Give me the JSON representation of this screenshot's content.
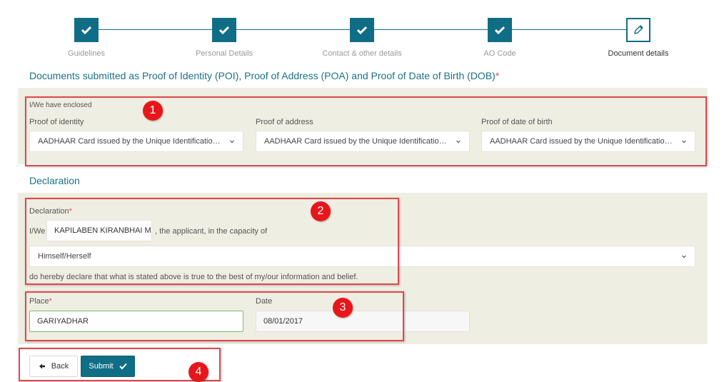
{
  "stepper": {
    "steps": [
      {
        "label": "Guidelines",
        "status": "complete",
        "icon": "check-icon"
      },
      {
        "label": "Personal Details",
        "status": "complete",
        "icon": "check-icon"
      },
      {
        "label": "Contact & other details",
        "status": "complete",
        "icon": "check-icon"
      },
      {
        "label": "AO Code",
        "status": "complete",
        "icon": "check-icon"
      },
      {
        "label": "Document details",
        "status": "current",
        "icon": "pencil-icon"
      }
    ]
  },
  "documents": {
    "title": "Documents submitted as Proof of Identity (POI), Proof of Address (POA) and Proof of Date of Birth (DOB)",
    "required_mark": "*",
    "enclosed_label": "I/We have enclosed",
    "poi": {
      "label": "Proof of identity",
      "value": "AADHAAR Card issued by the Unique Identification ..."
    },
    "poa": {
      "label": "Proof of address",
      "value": "AADHAAR Card issued by the Unique Identification ..."
    },
    "dob": {
      "label": "Proof of date of birth",
      "value": "AADHAAR Card issued by the Unique Identification ..."
    }
  },
  "declaration": {
    "title": "Declaration",
    "label": "Declaration",
    "required_mark": "*",
    "prefix": "I/We",
    "name_value": "KAPILABEN KIRANBHAI M",
    "middle_text": ", the applicant, in the capacity of",
    "capacity_value": "Himself/Herself",
    "statement": "do hereby declare that what is stated above is true to the best of my/our information and belief."
  },
  "place": {
    "label": "Place",
    "required_mark": "*",
    "value": "GARIYADHAR"
  },
  "date": {
    "label": "Date",
    "value": "08/01/2017"
  },
  "buttons": {
    "back": "Back",
    "submit": "Submit"
  },
  "annotations": [
    "1",
    "2",
    "3",
    "4"
  ],
  "colors": {
    "primary": "#0f6e85",
    "panel": "#efeee2",
    "annotation": "#e8161b",
    "required": "#d9534f"
  }
}
